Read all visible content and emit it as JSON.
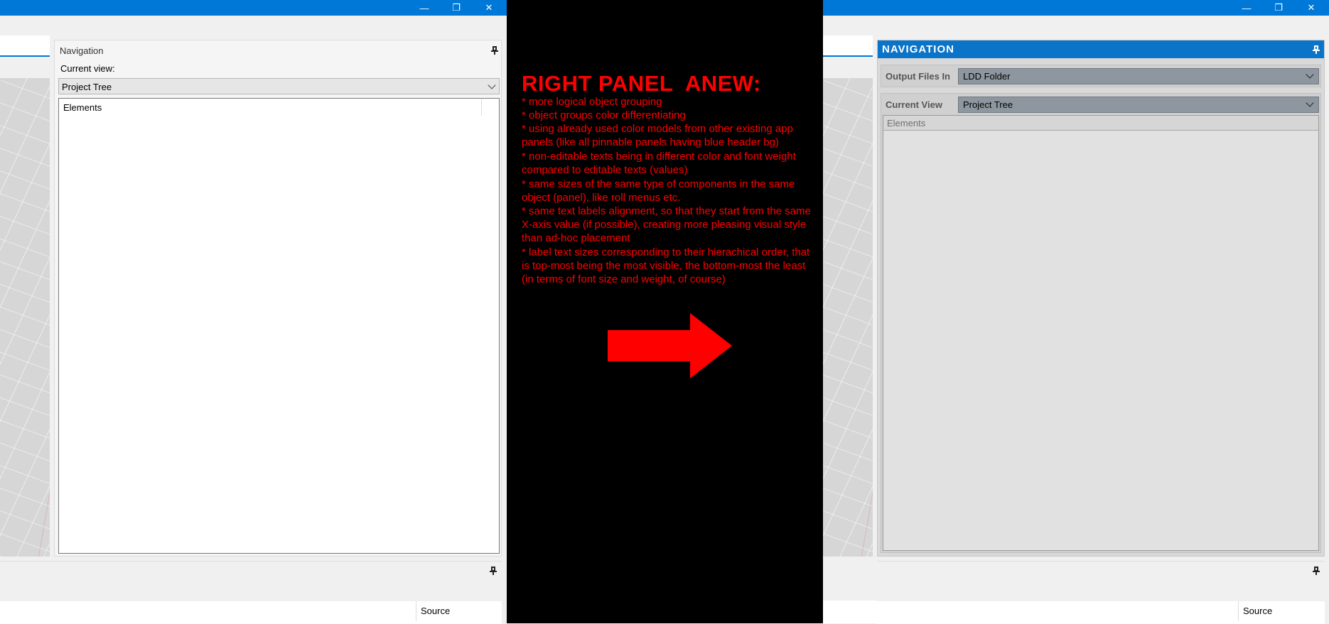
{
  "left": {
    "window_controls": {
      "minimize": "—",
      "maximize": "❐",
      "close": "✕"
    },
    "navigation": {
      "title": "Navigation",
      "current_view_label": "Current view:",
      "current_view_value": "Project Tree",
      "tree_header": "Elements"
    },
    "bottom": {
      "source_label": "Source"
    }
  },
  "center": {
    "heading": "RIGHT PANEL  ANEW:",
    "notes": [
      "* more logical object grouping",
      "* object groups color differentiating",
      "* using already used color models from other existing app panels (like all pinnable panels having blue header bg)",
      "* non-editable texts being in different color and font weight compared to editable texts (values)",
      "* same sizes of the same type of components in the same object (panel), like roll menus etc.",
      "* same text labels alignment, so that they start from the same X-axis value (if possible), creating more pleasing visual style than ad-hoc placement",
      "* label text sizes corresponding to their hierachical order, that is top-most being the most visible, the bottom-most the least (in terms of font size and weight, of course)"
    ],
    "arrow_color": "#ff0000"
  },
  "right": {
    "window_controls": {
      "minimize": "—",
      "maximize": "❐",
      "close": "✕"
    },
    "navigation": {
      "title": "NAVIGATION",
      "output_files_label": "Output Files In",
      "output_files_value": "LDD Folder",
      "current_view_label": "Current View",
      "current_view_value": "Project Tree",
      "tree_header": "Elements"
    },
    "bottom": {
      "source_label": "Source"
    }
  },
  "colors": {
    "accent": "#0078d7",
    "note_red": "#ff0000"
  }
}
